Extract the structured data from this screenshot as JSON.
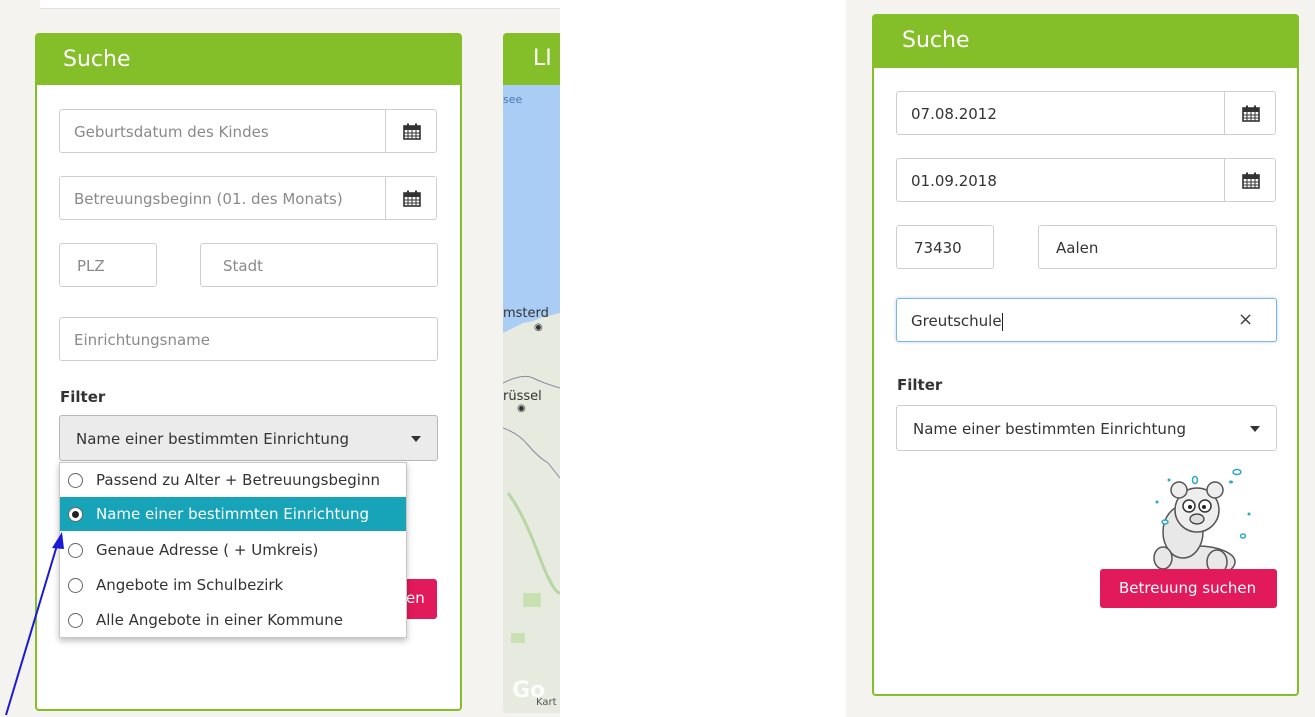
{
  "left": {
    "header": "Suche",
    "birthdate_placeholder": "Geburtsdatum des Kindes",
    "start_placeholder": "Betreuungsbeginn (01. des Monats)",
    "plz_placeholder": "PLZ",
    "city_placeholder": "Stadt",
    "facility_placeholder": "Einrichtungsname",
    "filter_label": "Filter",
    "filter_selected": "Name einer bestimmten Einrichtung",
    "filter_options": [
      "Passend zu Alter + Betreuungsbeginn",
      "Name einer bestimmten Einrichtung",
      "Genaue Adresse ( + Umkreis)",
      "Angebote im Schulbezirk",
      "Alle Angebote in einer Kommune"
    ],
    "search_button_partial": "en"
  },
  "map": {
    "header_partial": "LI",
    "label_see": "see",
    "label_amsterdam": "msterd",
    "label_bruessel": "rüssel",
    "label_google": "Go",
    "label_karten": "Kart"
  },
  "right": {
    "header": "Suche",
    "birthdate_value": "07.08.2012",
    "start_value": "01.09.2018",
    "plz_value": "73430",
    "city_value": "Aalen",
    "facility_value": "Greutschule",
    "clear_glyph": "×",
    "filter_label": "Filter",
    "filter_selected": "Name einer bestimmten Einrichtung",
    "search_button": "Betreuung suchen"
  },
  "colors": {
    "brand_green": "#84bf2a",
    "accent_pink": "#e2195b",
    "selected_teal": "#17a3b8",
    "annotation_arrow": "#1a1ad6"
  }
}
